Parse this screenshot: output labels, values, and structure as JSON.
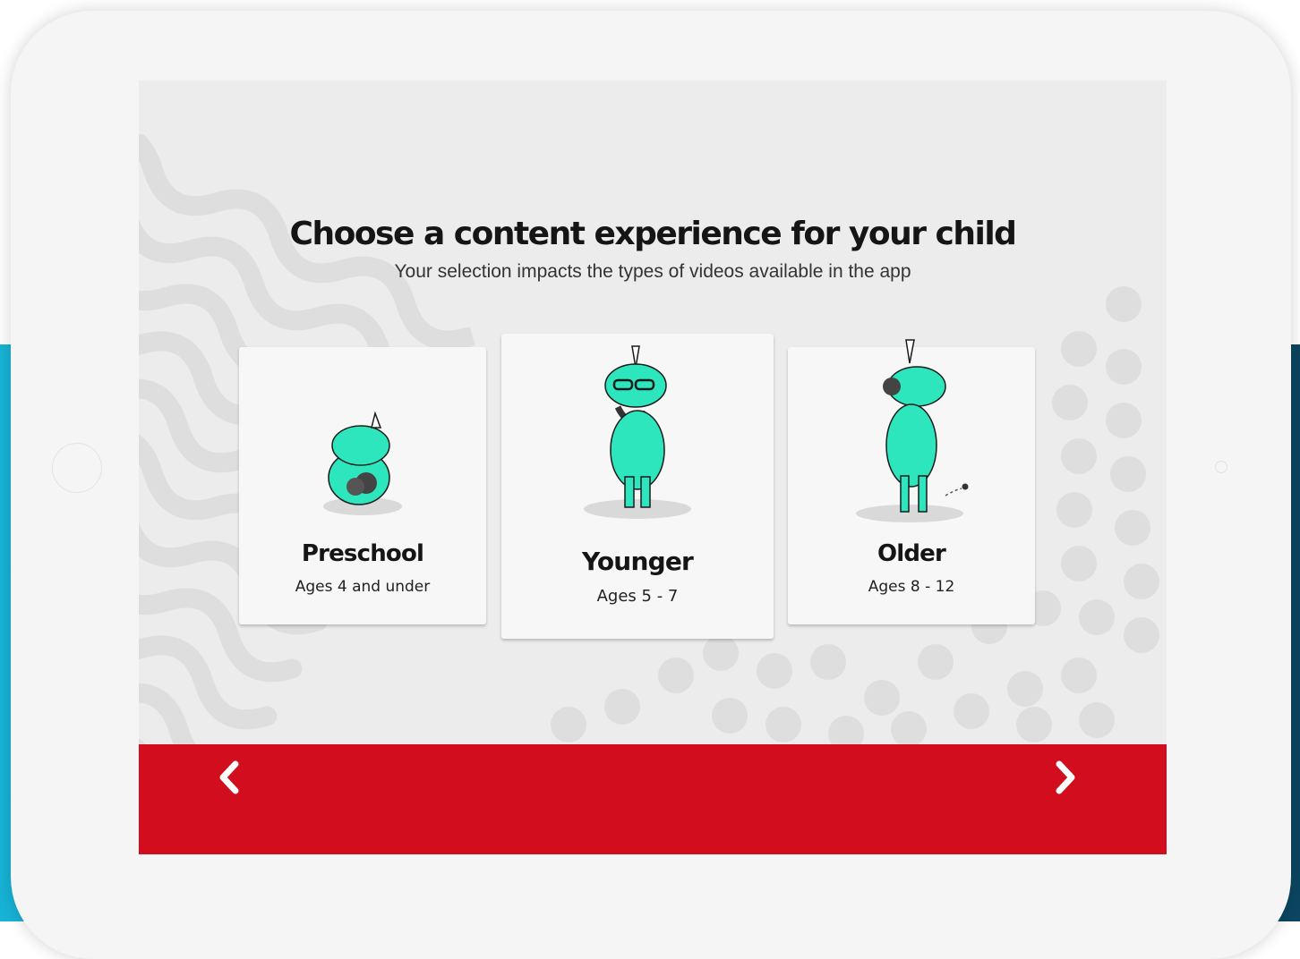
{
  "screen": {
    "title": "Choose a content experience for your child",
    "subtitle": "Your selection impacts the types of videos available in the app"
  },
  "options": [
    {
      "title": "Preschool",
      "ages": "Ages 4 and under",
      "icon": "sitting-unicorn-icon"
    },
    {
      "title": "Younger",
      "ages": "Ages 5 - 7",
      "icon": "unicorn-with-glasses-icon"
    },
    {
      "title": "Older",
      "ages": "Ages 8 - 12",
      "icon": "unicorn-with-headphones-icon"
    }
  ],
  "selected_option": "Younger",
  "navigation": {
    "back_icon": "chevron-left-icon",
    "next_icon": "chevron-right-icon"
  },
  "colors": {
    "nav_bar": "#d10d1e",
    "unicorn": "#2ee6bd",
    "background": "#ececec"
  }
}
